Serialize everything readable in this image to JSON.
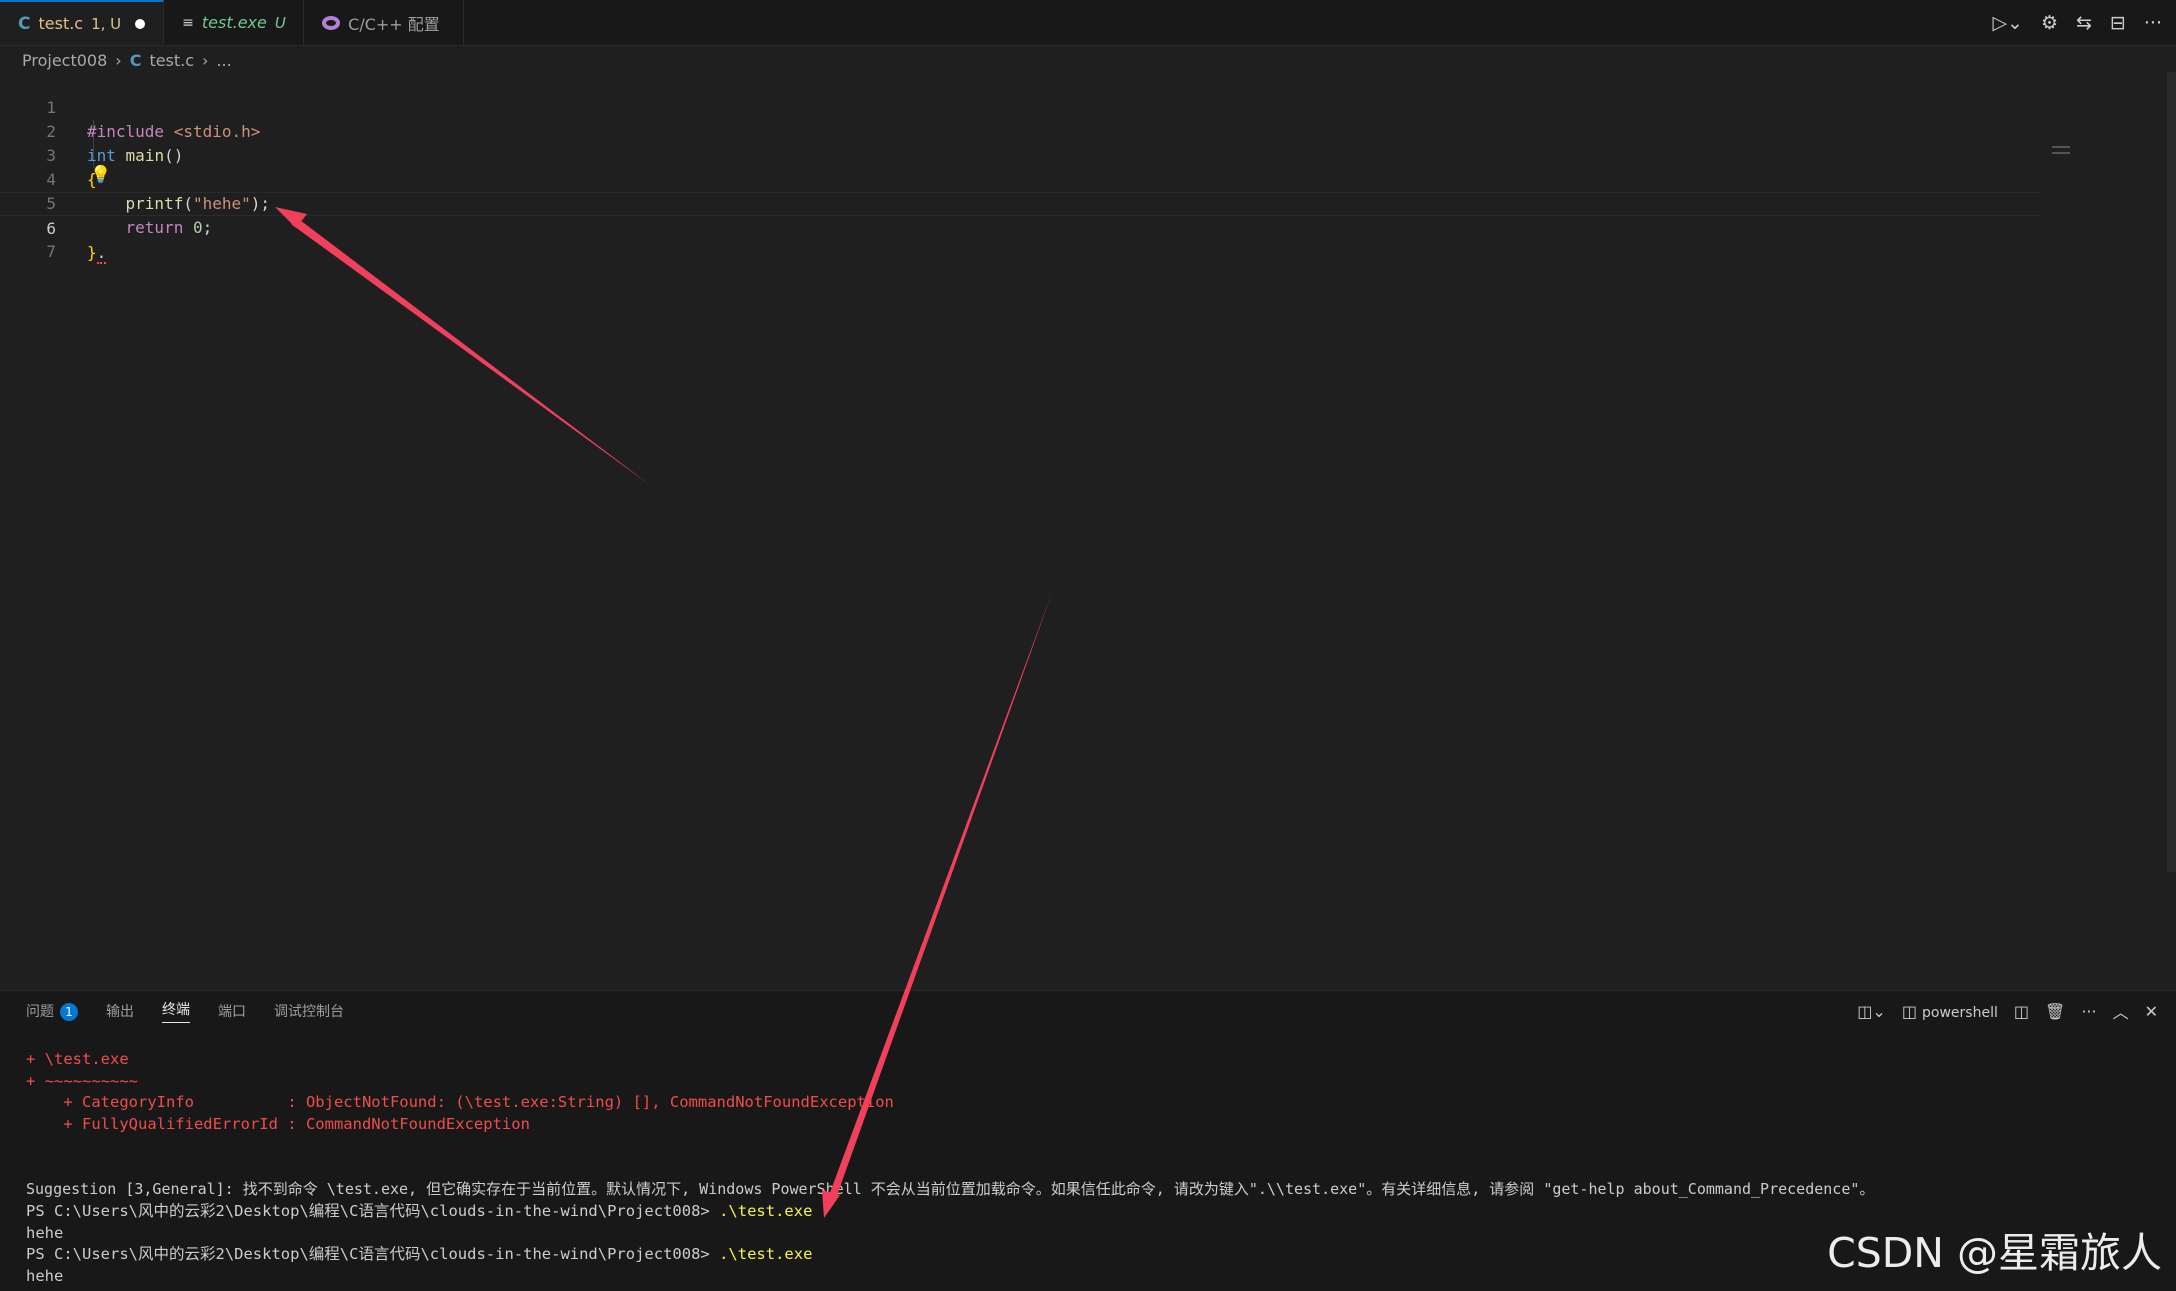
{
  "tabs": [
    {
      "icon": "C",
      "name": "test.c",
      "badge": "1, U",
      "dirty": true,
      "active": true
    },
    {
      "icon": "≡",
      "name": "test.exe",
      "badge": "U",
      "active": false
    },
    {
      "icon": "cfg",
      "name": "C/C++ 配置",
      "active": false
    }
  ],
  "breadcrumb": {
    "folder": "Project008",
    "sep": "›",
    "file_icon": "C",
    "file": "test.c",
    "more": "..."
  },
  "code_lines": [
    {
      "num": "1"
    },
    {
      "num": "2"
    },
    {
      "num": "3"
    },
    {
      "num": "4"
    },
    {
      "num": "5"
    },
    {
      "num": "6"
    },
    {
      "num": "7"
    }
  ],
  "code": {
    "l1_pre": "#include",
    "l1_hdr": "<stdio.h>",
    "l2_kw": "int",
    "l2_fn": "main",
    "l2_paren": "()",
    "l3": "{",
    "l4_fn": "printf",
    "l4_open": "(",
    "l4_str": "\"hehe\"",
    "l4_close": ");",
    "l5_kw": "return",
    "l5_num": "0",
    "l5_semi": ";",
    "l6_brace": "}",
    "l6_dot": "."
  },
  "panel": {
    "tabs": [
      "问题",
      "输出",
      "终端",
      "端口",
      "调试控制台"
    ],
    "problems_count": "1",
    "active_tab": "终端",
    "shell": "powershell"
  },
  "terminal": {
    "l1": "+ \\test.exe",
    "l2": "+ ~~~~~~~~~~",
    "l3": "    + CategoryInfo          : ObjectNotFound: (\\test.exe:String) [], CommandNotFoundException",
    "l4": "    + FullyQualifiedErrorId : CommandNotFoundException",
    "l5": "Suggestion [3,General]: 找不到命令 \\test.exe, 但它确实存在于当前位置。默认情况下, Windows PowerShell 不会从当前位置加载命令。如果信任此命令, 请改为键入\".\\\\test.exe\"。有关详细信息, 请参阅 \"get-help about_Command_Precedence\"。",
    "prompt": "PS C:\\Users\\风中的云彩2\\Desktop\\编程\\C语言代码\\clouds-in-the-wind\\Project008> ",
    "cmd": ".\\test.exe",
    "out": "hehe"
  },
  "watermark": "CSDN @星霜旅人",
  "colors": {
    "accent": "#0078d4",
    "arrow": "#f0405c"
  }
}
